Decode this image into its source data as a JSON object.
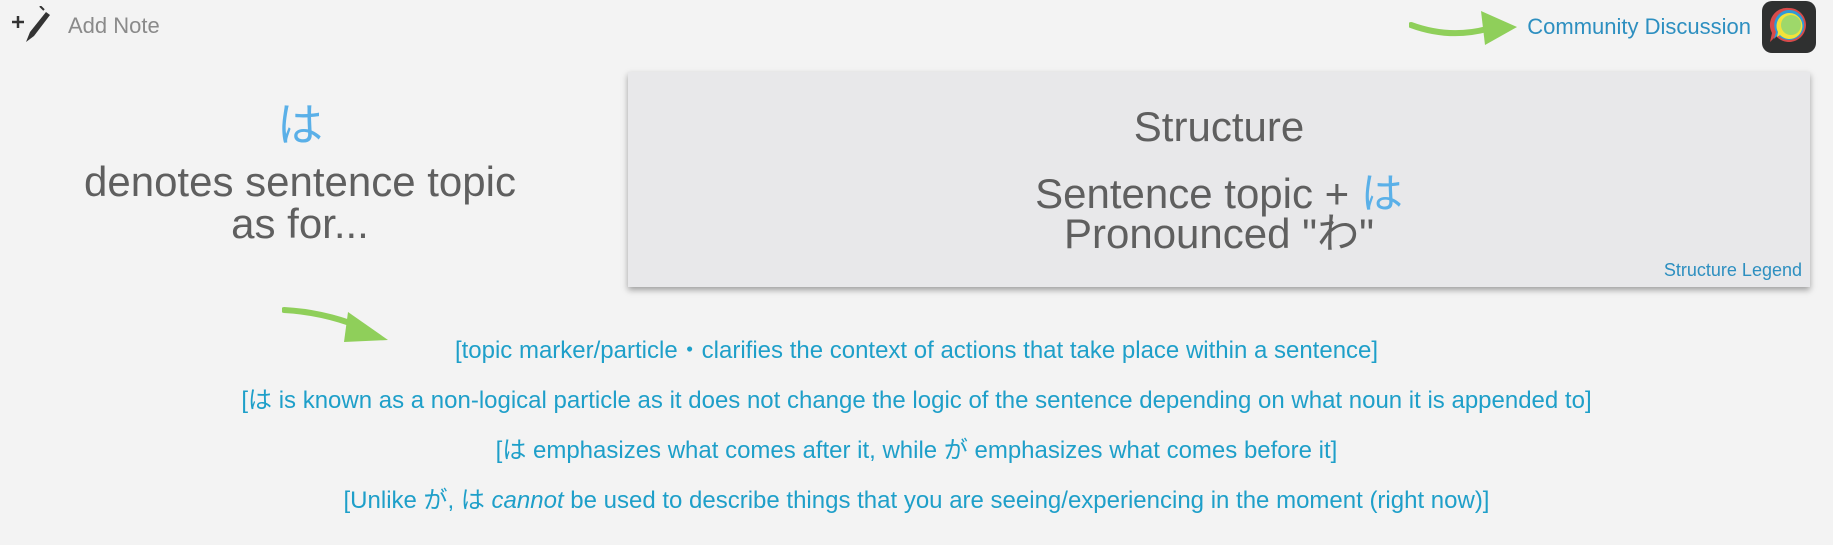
{
  "toolbar": {
    "add_note_label": "Add Note",
    "community_link_label": "Community Discussion"
  },
  "vocab": {
    "kana": "は",
    "meaning_line1": "denotes sentence topic",
    "meaning_line2": "as for..."
  },
  "structure": {
    "title": "Structure",
    "line1_text": "Sentence topic + ",
    "line1_kana": "は",
    "line2_prefix": "Pronounced \"",
    "line2_kana": "わ",
    "line2_suffix": "\"",
    "legend_label": "Structure Legend"
  },
  "notes": {
    "line1": "[topic marker/particle・clarifies the context of actions that take place within a sentence]",
    "line2": "[は is known as a non-logical particle as it does not change the logic of the sentence depending on what noun it is appended to]",
    "line3": "[は emphasizes what comes after it, while が emphasizes what comes before it]",
    "line4_before": "[Unlike が, は ",
    "line4_emph": "cannot",
    "line4_after": " be used to describe things that you are seeing/experiencing in the moment (right now)]"
  },
  "colors": {
    "background": "#f3f3f3",
    "accent_blue": "#2d8fc0",
    "kana_blue": "#5ab0e8",
    "note_blue": "#1e9fc9",
    "arrow_green": "#8fcf5a",
    "text_gray": "#5f5f5f"
  },
  "icons": {
    "add_note": "plus-pencil-icon",
    "discussion": "chat-bubble-icon",
    "arrow": "green-arrow-icon"
  }
}
